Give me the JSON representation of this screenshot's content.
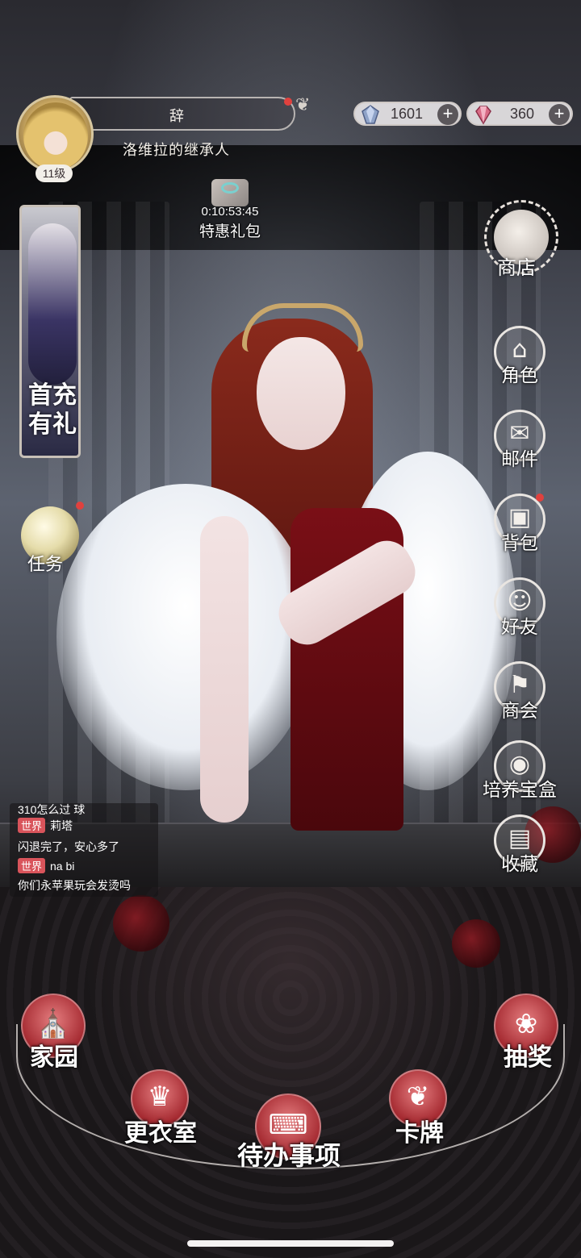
{
  "player": {
    "name": "辞",
    "title": "洛维拉的继承人",
    "level": "11级",
    "avatar_icon": "player-avatar-portrait"
  },
  "currencies": [
    {
      "icon": "crystal-gem-icon",
      "value": "1601",
      "color": "#8fa3c8"
    },
    {
      "icon": "pink-diamond-icon",
      "value": "360",
      "color": "#d86b86"
    }
  ],
  "plus_symbol": "+",
  "gift": {
    "timer": "0:10:53:45",
    "label": "特惠礼包"
  },
  "first_recharge": {
    "label_line1": "首充",
    "label_line2": "有礼"
  },
  "task": {
    "label": "任务"
  },
  "shop": {
    "label": "商店"
  },
  "side_menu": [
    {
      "id": "character",
      "label": "角色",
      "icon": "top-hat-icon",
      "glyph": "⌂",
      "badge": false
    },
    {
      "id": "mail",
      "label": "邮件",
      "icon": "envelope-icon",
      "glyph": "✉",
      "badge": false
    },
    {
      "id": "bag",
      "label": "背包",
      "icon": "backpack-icon",
      "glyph": "▣",
      "badge": true
    },
    {
      "id": "friends",
      "label": "好友",
      "icon": "friends-icon",
      "glyph": "☺",
      "badge": false
    },
    {
      "id": "guild",
      "label": "商会",
      "icon": "banner-icon",
      "glyph": "⚑",
      "badge": false
    },
    {
      "id": "box",
      "label": "培养宝盒",
      "icon": "hat-box-icon",
      "glyph": "◉",
      "badge": false
    },
    {
      "id": "collection",
      "label": "收藏",
      "icon": "book-icon",
      "glyph": "▤",
      "badge": false
    }
  ],
  "chat": {
    "lines": [
      {
        "channel": "",
        "text": "310怎么过 球"
      },
      {
        "channel": "世界",
        "text": "莉塔"
      },
      {
        "channel": "",
        "text": "闪退完了，安心多了"
      },
      {
        "channel": "世界",
        "text": "na bi"
      },
      {
        "channel": "",
        "text": "你们永苹果玩会发烫吗"
      }
    ]
  },
  "bottom_nav": [
    {
      "id": "home",
      "label": "家园",
      "icon": "gothic-window-icon",
      "glyph": "⛪"
    },
    {
      "id": "wardrobe",
      "label": "更衣室",
      "icon": "dress-form-icon",
      "glyph": "♛"
    },
    {
      "id": "todo",
      "label": "待办事项",
      "icon": "typewriter-icon",
      "glyph": "⌨"
    },
    {
      "id": "cards",
      "label": "卡牌",
      "icon": "card-icon",
      "glyph": "❦"
    },
    {
      "id": "draw",
      "label": "抽奖",
      "icon": "rose-icon",
      "glyph": "❀"
    }
  ],
  "colors": {
    "accent_red": "#a52a31",
    "badge_red": "#e0413e",
    "chat_channel": "#d9545b"
  }
}
